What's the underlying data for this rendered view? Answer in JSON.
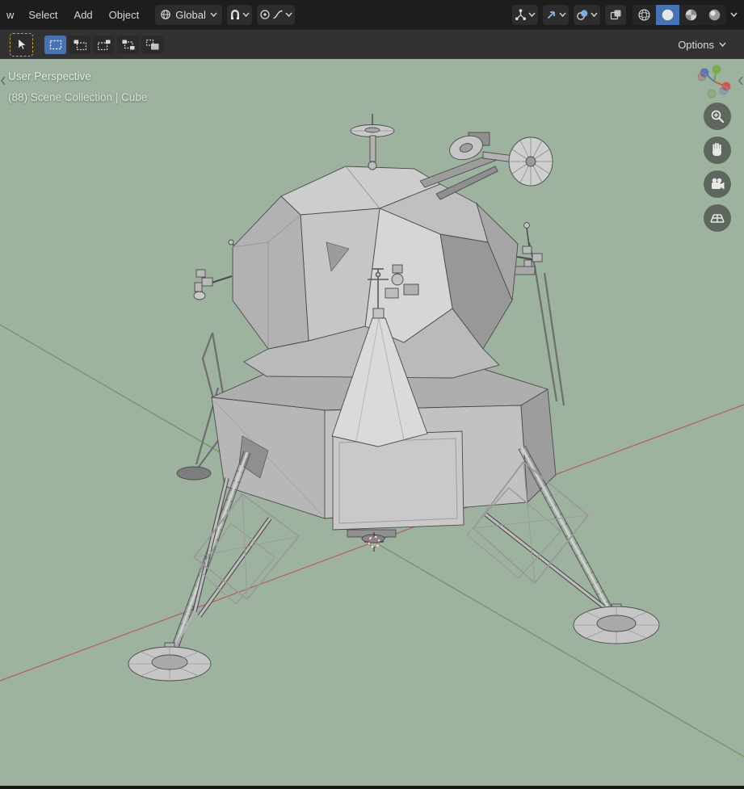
{
  "topbar": {
    "menu_truncated_label": "w",
    "menus": [
      {
        "label": "Select"
      },
      {
        "label": "Add"
      },
      {
        "label": "Object"
      }
    ],
    "transform_orientation": {
      "value": "Global"
    }
  },
  "toolbar": {
    "options_label": "Options"
  },
  "viewport": {
    "perspective_label": "User Perspective",
    "breadcrumb": "(88) Scene Collection | Cube",
    "nav_buttons": [
      {
        "name": "zoom"
      },
      {
        "name": "pan"
      },
      {
        "name": "camera-view"
      },
      {
        "name": "perspective-grid"
      }
    ]
  },
  "icons": {
    "topbar_right": [
      "show-gizmo",
      "navigate-arrow",
      "overlays",
      "xray",
      "shading-wireframe",
      "shading-solid",
      "shading-material",
      "shading-rendered"
    ],
    "active_shading": "solid",
    "active_select_mode": "tweak"
  },
  "colors": {
    "viewport_bg": "#9db3a0",
    "topbar_bg": "#1d1d1d",
    "toolbar_bg": "#323232",
    "accent": "#4772b3",
    "active_tool_outline": "#c8a23f",
    "axis_x": "#b4575a",
    "axis_y": "#5f9150"
  }
}
